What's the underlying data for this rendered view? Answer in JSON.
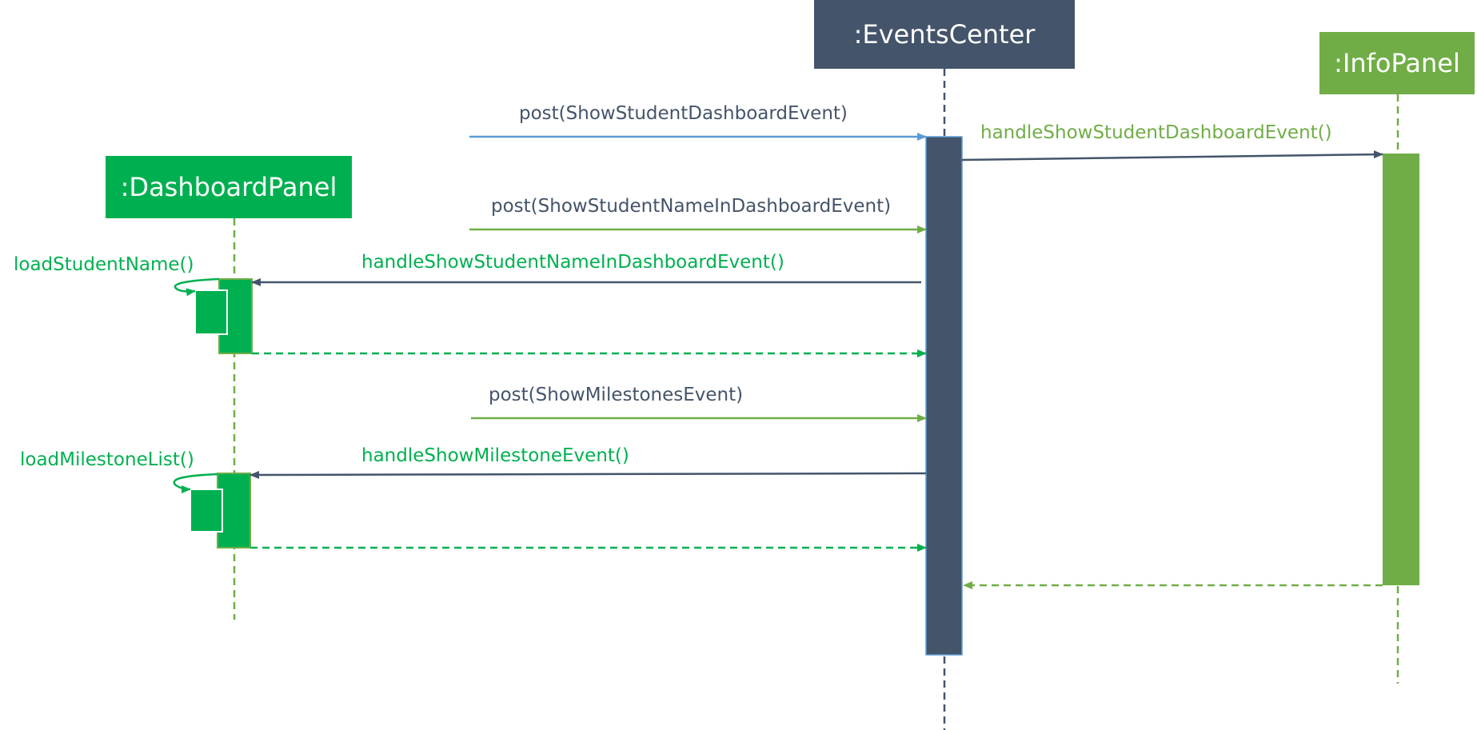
{
  "participants": {
    "events_center": ":EventsCenter",
    "info_panel": ":InfoPanel",
    "dashboard_panel": ":DashboardPanel"
  },
  "messages": {
    "post_show_student_dashboard": "post(ShowStudentDashboardEvent)",
    "handle_show_student_dashboard": "handleShowStudentDashboardEvent()",
    "post_show_student_name": "post(ShowStudentNameInDashboardEvent)",
    "handle_show_student_name": "handleShowStudentNameInDashboardEvent()",
    "load_student_name": "loadStudentName()",
    "post_show_milestones": "post(ShowMilestonesEvent)",
    "handle_show_milestone": "handleShowMilestoneEvent()",
    "load_milestone_list": "loadMilestoneList()"
  },
  "colors": {
    "events_center": "#44546a",
    "info_panel": "#70ad47",
    "dashboard_panel": "#00b050",
    "blue_arrow": "#5b9bd5"
  }
}
